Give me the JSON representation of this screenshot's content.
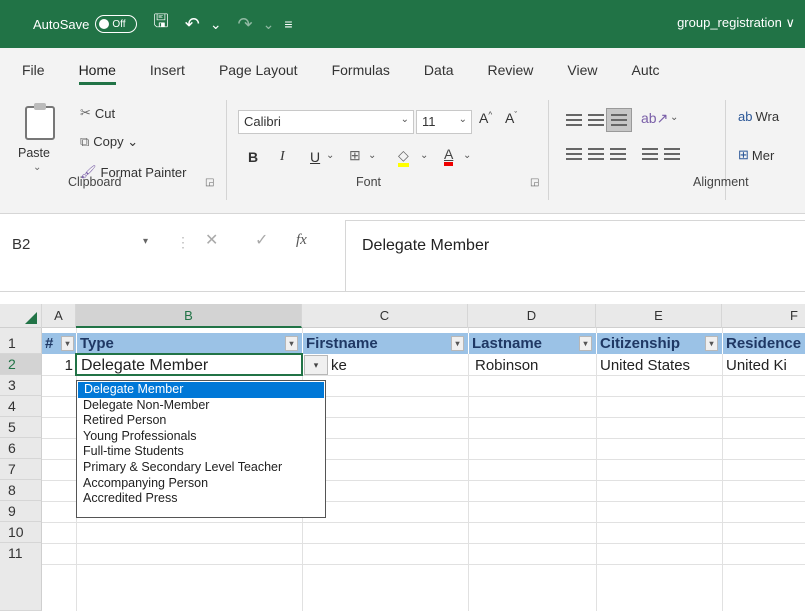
{
  "title_bar": {
    "autosave_label": "AutoSave",
    "autosave_state": "Off",
    "filename": "group_registration ∨",
    "save_icon": "save-icon",
    "undo_icon": "undo-icon",
    "redo_icon": "redo-icon",
    "customize_icon": "customize-icon"
  },
  "ribbon_tabs": [
    "File",
    "Home",
    "Insert",
    "Page Layout",
    "Formulas",
    "Data",
    "Review",
    "View",
    "Autc"
  ],
  "active_tab": "Home",
  "ribbon": {
    "clipboard": {
      "paste": "Paste",
      "cut": "Cut",
      "copy": "Copy ⌄",
      "format_painter": "Format Painter",
      "label": "Clipboard"
    },
    "font": {
      "font_name": "Calibri",
      "font_size": "11",
      "label": "Font",
      "bold": "B",
      "italic": "I",
      "underline": "U"
    },
    "alignment": {
      "wrap": "Wra",
      "merge": "Mer",
      "label": "Alignment"
    }
  },
  "formula_bar": {
    "name_box": "B2",
    "fx": "fx",
    "content": "Delegate Member"
  },
  "columns": [
    "A",
    "B",
    "C",
    "D",
    "E",
    "F"
  ],
  "selected_column": "B",
  "rows": [
    "1",
    "2",
    "3",
    "4",
    "5",
    "6",
    "7",
    "8",
    "9",
    "10",
    "11"
  ],
  "header_row": [
    "#",
    "Type",
    "Firstname",
    "Lastname",
    "Citizenship",
    "Residence"
  ],
  "data_row": {
    "num": "1",
    "type": "Delegate Member",
    "firstname": "ke",
    "lastname": "Robinson",
    "citizenship": "United States",
    "residence": "United Ki"
  },
  "dropdown_options": [
    "Delegate Member",
    "Delegate Non-Member",
    "Retired Person",
    "Young Professionals",
    "Full-time Students",
    "Primary & Secondary Level Teacher",
    "Accompanying Person",
    "Accredited Press"
  ],
  "dropdown_selected": "Delegate Member",
  "colors": {
    "excel_green": "#217346",
    "header_fill": "#9bc2e6",
    "selection_blue": "#0078d7"
  }
}
